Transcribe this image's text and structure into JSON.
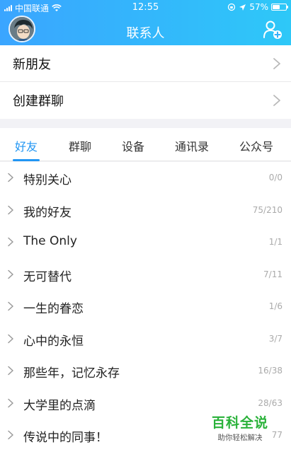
{
  "status_bar": {
    "carrier": "中国联通",
    "time": "12:55",
    "battery": "57%",
    "battery_level": 0.57
  },
  "header": {
    "title": "联系人",
    "avatar_icon": "avatar-icon",
    "add_icon": "add-contact-icon"
  },
  "menu": {
    "items": [
      {
        "label": "新朋友"
      },
      {
        "label": "创建群聊"
      }
    ]
  },
  "tabs": [
    {
      "label": "好友",
      "active": true
    },
    {
      "label": "群聊",
      "active": false
    },
    {
      "label": "设备",
      "active": false
    },
    {
      "label": "通讯录",
      "active": false
    },
    {
      "label": "公众号",
      "active": false
    }
  ],
  "groups": [
    {
      "name": "特别关心",
      "count": "0/0"
    },
    {
      "name": "我的好友",
      "count": "75/210"
    },
    {
      "name": "The Only",
      "count": "1/1"
    },
    {
      "name": "无可替代",
      "count": "7/11"
    },
    {
      "name": "一生的眷恋",
      "count": "1/6"
    },
    {
      "name": "心中的永恒",
      "count": "3/7"
    },
    {
      "name": "那些年，记忆永存",
      "count": "16/38"
    },
    {
      "name": "大学里的点滴",
      "count": "28/63"
    },
    {
      "name": "传说中的同事！",
      "count": "77"
    }
  ],
  "watermark": {
    "main": "百科全说",
    "sub": "助你轻松解决"
  },
  "colors": {
    "accent": "#2196f3",
    "header_gradient_start": "#3aa5ff",
    "header_gradient_end": "#2ec8f8"
  }
}
